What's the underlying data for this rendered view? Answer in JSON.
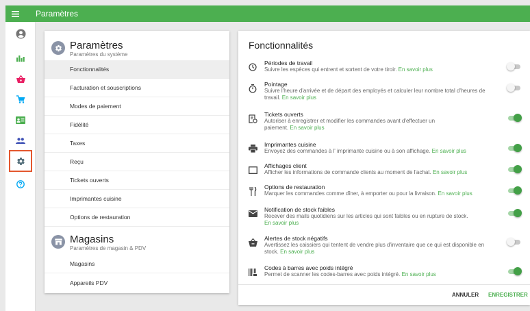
{
  "topbar": {
    "title": "Paramètres",
    "menu_icon": "hamburger-icon"
  },
  "rail": {
    "items": [
      {
        "name": "account-icon",
        "color": "#757575"
      },
      {
        "name": "reports-icon",
        "color": "#4caf50"
      },
      {
        "name": "items-basket-icon",
        "color": "#e91e63"
      },
      {
        "name": "sales-cart-icon",
        "color": "#03a9f4"
      },
      {
        "name": "employees-card-icon",
        "color": "#4caf50"
      },
      {
        "name": "customers-icon",
        "color": "#3f51b5"
      },
      {
        "name": "settings-gear-icon",
        "color": "#546e7a",
        "active": true
      },
      {
        "name": "help-icon",
        "color": "#03a9f4"
      }
    ],
    "active_color": "#e4572e"
  },
  "sections": {
    "settings": {
      "title": "Paramètres",
      "subtitle": "Paramètres du système",
      "items": [
        "Fonctionnalités",
        "Facturation et souscriptions",
        "Modes de paiement",
        "Fidélité",
        "Taxes",
        "Reçu",
        "Tickets ouverts",
        "Imprimantes cuisine",
        "Options de restauration"
      ],
      "selected": "Fonctionnalités"
    },
    "stores": {
      "title": "Magasins",
      "subtitle": "Paramètres de magasin & PDV",
      "items": [
        "Magasins",
        "Appareils PDV"
      ]
    }
  },
  "features": {
    "title": "Fonctionnalités",
    "link_label": "En savoir plus",
    "items": [
      {
        "icon": "clock-icon",
        "name": "Périodes de travail",
        "desc": "Suivre les espèces qui entrent et sortent de votre tiroir.",
        "enabled": false
      },
      {
        "icon": "stopwatch-icon",
        "name": "Pointage",
        "desc": "Suivre l'heure d'arrivée et de départ des employés et calculer leur nombre total d'heures de travail.",
        "enabled": false
      },
      {
        "icon": "open-tickets-icon",
        "name": "Tickets ouverts",
        "desc": "Autoriser à enregistrer et modifier les commandes avant d'effectuer un paiement.",
        "enabled": true
      },
      {
        "icon": "printer-icon",
        "name": "Imprimantes cuisine",
        "desc": "Envoyez des commandes à l' imprimante cuisine ou à son affichage.",
        "enabled": true
      },
      {
        "icon": "monitor-icon",
        "name": "Affichages client",
        "desc": "Afficher les informations de commande clients au moment de l'achat.",
        "enabled": true
      },
      {
        "icon": "fork-knife-icon",
        "name": "Options de restauration",
        "desc": "Marquer les commandes comme dîner, à emporter ou pour la livraison.",
        "enabled": true
      },
      {
        "icon": "envelope-icon",
        "name": "Notification de stock faibles",
        "desc": "Recever des mails quotidiens sur les articles qui sont faibles ou en rupture de stock.",
        "enabled": true
      },
      {
        "icon": "negative-stock-icon",
        "name": "Alertes de stock négatifs",
        "desc": "Avertissez les caissiers qui tentent de vendre plus d'inventaire que ce qui est disponible en stock.",
        "enabled": false
      },
      {
        "icon": "barcode-icon",
        "name": "Codes à barres avec poids intégré",
        "desc": "Permet de scanner les codes-barres avec poids intégré.",
        "enabled": true
      }
    ]
  },
  "actions": {
    "cancel_label": "ANNULER",
    "save_label": "ENREGISTRER"
  },
  "colors": {
    "accent": "#4caf50",
    "toggle_on": "#43a047"
  }
}
